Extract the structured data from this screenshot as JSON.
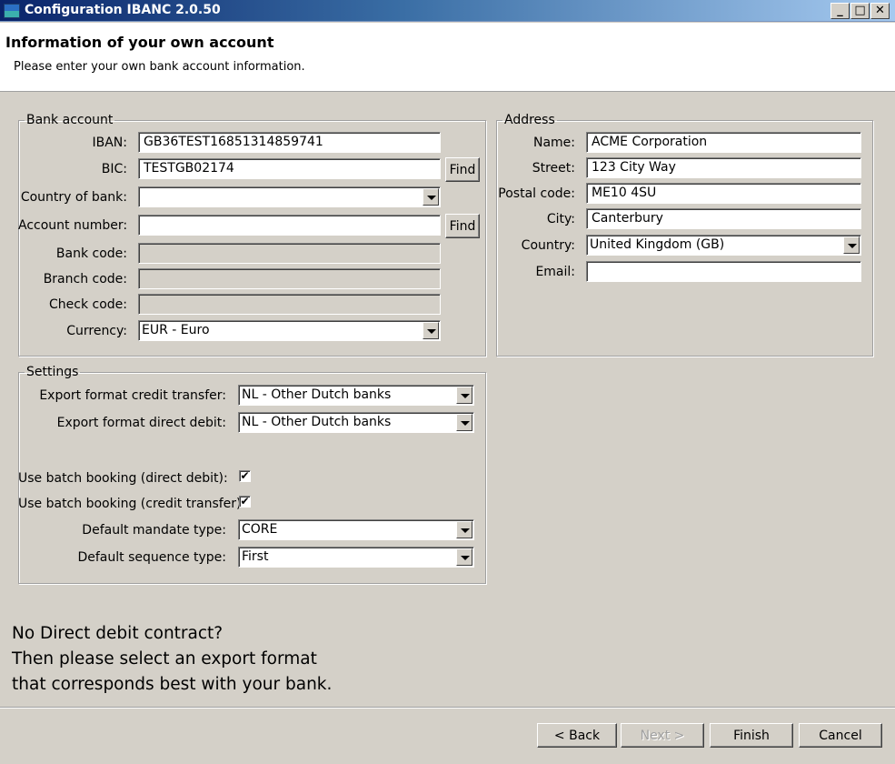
{
  "window": {
    "title": "Configuration IBANC 2.0.50",
    "minimize": "_",
    "maximize": "□",
    "close": "✕",
    "icon": "app-icon"
  },
  "header": {
    "title": "Information of your own account",
    "subtitle": "Please enter your own bank account information."
  },
  "bank_account": {
    "legend": "Bank account",
    "iban_label": "IBAN:",
    "iban_value": "GB36TEST16851314859741",
    "bic_label": "BIC:",
    "bic_value": "TESTGB02174",
    "find_label": "Find",
    "country_label": "Country of bank:",
    "country_value": "",
    "account_number_label": "Account number:",
    "account_number_value": "",
    "bank_code_label": "Bank code:",
    "branch_code_label": "Branch code:",
    "check_code_label": "Check code:",
    "currency_label": "Currency:",
    "currency_value": "EUR - Euro"
  },
  "address": {
    "legend": "Address",
    "name_label": "Name:",
    "name_value": "ACME Corporation",
    "street_label": "Street:",
    "street_value": "123 City Way",
    "postal_label": "Postal code:",
    "postal_value": "ME10 4SU",
    "city_label": "City:",
    "city_value": "Canterbury",
    "country_label": "Country:",
    "country_value": "United Kingdom (GB)",
    "email_label": "Email:",
    "email_value": ""
  },
  "settings": {
    "legend": "Settings",
    "export_credit_label": "Export format credit transfer:",
    "export_credit_value": "NL - Other Dutch banks",
    "export_debit_label": "Export format direct debit:",
    "export_debit_value": "NL - Other Dutch banks",
    "batch_debit_label": "Use batch booking (direct debit):",
    "batch_debit_checked": "✔",
    "batch_credit_label": "Use batch booking (credit transfer):",
    "batch_credit_checked": "✔",
    "mandate_label": "Default mandate type:",
    "mandate_value": "CORE",
    "sequence_label": "Default sequence type:",
    "sequence_value": "First"
  },
  "note": {
    "line1": "No Direct debit contract?",
    "line2": "Then please select an export format",
    "line3": "that corresponds best with your bank."
  },
  "footer": {
    "back_label": "< Back",
    "next_label": "Next >",
    "finish_label": "Finish",
    "cancel_label": "Cancel"
  }
}
